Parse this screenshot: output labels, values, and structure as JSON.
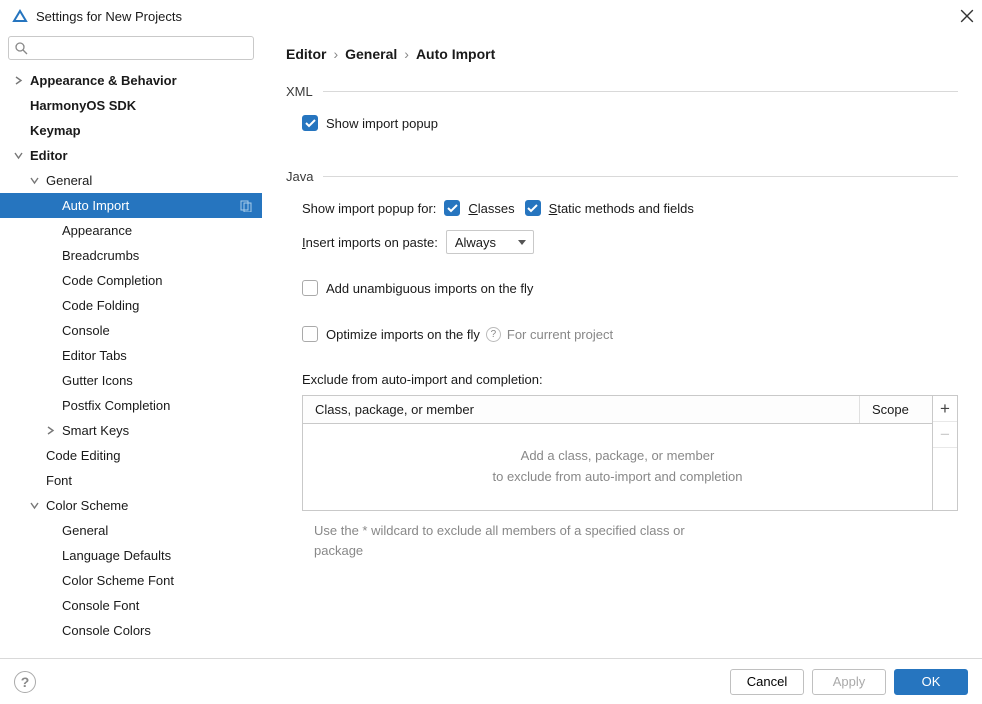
{
  "titlebar": {
    "title": "Settings for New Projects"
  },
  "search": {
    "placeholder": ""
  },
  "tree": [
    {
      "label": "Appearance & Behavior",
      "level": 0,
      "bold": true,
      "chevron": "right"
    },
    {
      "label": "HarmonyOS SDK",
      "level": 0,
      "bold": true
    },
    {
      "label": "Keymap",
      "level": 0,
      "bold": true
    },
    {
      "label": "Editor",
      "level": 0,
      "bold": true,
      "chevron": "down"
    },
    {
      "label": "General",
      "level": 1,
      "chevron": "down"
    },
    {
      "label": "Auto Import",
      "level": 2,
      "selected": true,
      "badge": true
    },
    {
      "label": "Appearance",
      "level": 2
    },
    {
      "label": "Breadcrumbs",
      "level": 2
    },
    {
      "label": "Code Completion",
      "level": 2
    },
    {
      "label": "Code Folding",
      "level": 2
    },
    {
      "label": "Console",
      "level": 2
    },
    {
      "label": "Editor Tabs",
      "level": 2
    },
    {
      "label": "Gutter Icons",
      "level": 2
    },
    {
      "label": "Postfix Completion",
      "level": 2
    },
    {
      "label": "Smart Keys",
      "level": 2,
      "chevron": "right"
    },
    {
      "label": "Code Editing",
      "level": 1
    },
    {
      "label": "Font",
      "level": 1
    },
    {
      "label": "Color Scheme",
      "level": 1,
      "chevron": "down"
    },
    {
      "label": "General",
      "level": 2
    },
    {
      "label": "Language Defaults",
      "level": 2
    },
    {
      "label": "Color Scheme Font",
      "level": 2
    },
    {
      "label": "Console Font",
      "level": 2
    },
    {
      "label": "Console Colors",
      "level": 2
    }
  ],
  "breadcrumb": [
    "Editor",
    "General",
    "Auto Import"
  ],
  "sections": {
    "xml": {
      "title": "XML",
      "show_import_popup": {
        "label": "Show import popup",
        "checked": true
      }
    },
    "java": {
      "title": "Java",
      "show_import_for_label": "Show import popup for:",
      "classes": {
        "label": "Classes",
        "prefix": "C",
        "checked": true
      },
      "static": {
        "label": "Static methods and fields",
        "prefix": "S",
        "checked": true
      },
      "insert_label": "Insert imports on paste:",
      "insert_prefix": "I",
      "insert_value": "Always",
      "unambiguous": {
        "label": "Add unambiguous imports on the fly",
        "checked": false
      },
      "optimize": {
        "label": "Optimize imports on the fly",
        "checked": false,
        "note": "For current project"
      },
      "exclude_label": "Exclude from auto-import and completion:",
      "exclude_col1": "Class, package, or member",
      "exclude_col2": "Scope",
      "exclude_empty_l1": "Add a class, package, or member",
      "exclude_empty_l2": "to exclude from auto-import and completion",
      "exclude_hint": "Use the * wildcard to exclude all members of a specified class or package"
    }
  },
  "footer": {
    "cancel": "Cancel",
    "apply": "Apply",
    "ok": "OK"
  }
}
